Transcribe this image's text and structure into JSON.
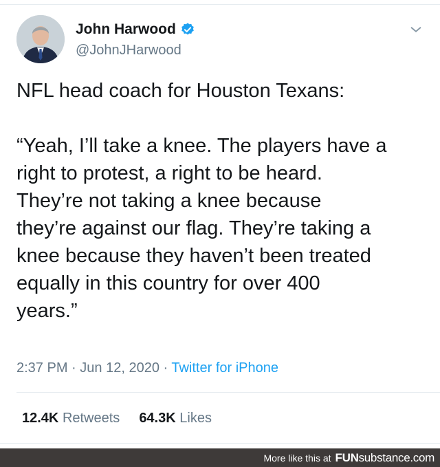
{
  "tweet": {
    "author_name": "John Harwood",
    "author_handle": "@JohnJHarwood",
    "verified_icon": "verified-badge-icon",
    "avatar": "avatar",
    "menu_icon": "chevron-down-icon",
    "text_lines": [
      "NFL head coach for Houston Texans:",
      "",
      "“Yeah, I’ll take a knee. The players have a",
      "right to protest, a right to be heard.",
      "They’re not taking a knee because",
      "they’re against our flag. They’re taking a",
      "knee because they haven’t been treated",
      "equally in this country for over 400",
      "years.”"
    ],
    "time": "2:37 PM",
    "separator": "·",
    "date": "Jun 12, 2020",
    "source": "Twitter for iPhone",
    "retweets_count": "12.4K",
    "retweets_label": "Retweets",
    "likes_count": "64.3K",
    "likes_label": "Likes"
  },
  "footer": {
    "more_text": "More like this at",
    "brand_bold": "FUN",
    "brand_rest": "substance",
    "brand_suffix": ".com",
    "background": "#3e3a39"
  },
  "colors": {
    "accent": "#1da1f2",
    "text": "#14171a",
    "muted": "#657786"
  }
}
